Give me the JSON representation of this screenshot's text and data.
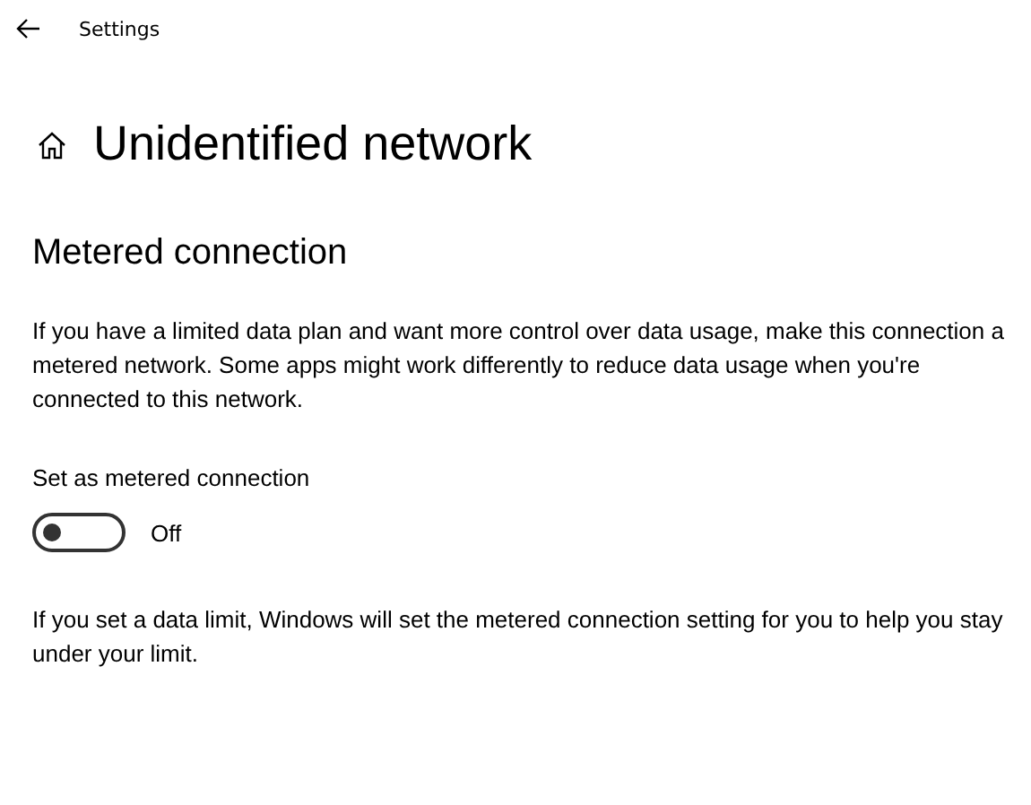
{
  "window": {
    "title": "Settings"
  },
  "page": {
    "title": "Unidentified network"
  },
  "section": {
    "heading": "Metered connection",
    "description": "If you have a limited data plan and want more control over data usage, make this connection a metered network. Some apps might work differently to reduce data usage when you're connected to this network.",
    "toggle": {
      "label": "Set as metered connection",
      "on": false,
      "state_text": "Off"
    },
    "note": "If you set a data limit, Windows will set the metered connection setting for you to help you stay under your limit."
  }
}
